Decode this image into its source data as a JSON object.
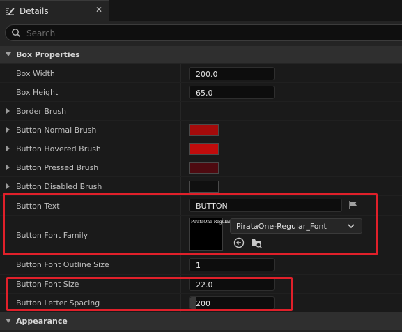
{
  "tab": {
    "title": "Details",
    "close": "✕"
  },
  "search": {
    "placeholder": "Search"
  },
  "categories": [
    {
      "label": "Box Properties"
    },
    {
      "label": "Appearance"
    }
  ],
  "properties": {
    "box_width": {
      "label": "Box Width",
      "value": "200.0"
    },
    "box_height": {
      "label": "Box Height",
      "value": "65.0"
    },
    "border_brush": {
      "label": "Border Brush"
    },
    "normal_brush": {
      "label": "Button Normal Brush",
      "color": "#a40b0b"
    },
    "hovered_brush": {
      "label": "Button Hovered Brush",
      "color": "#c00c0c"
    },
    "pressed_brush": {
      "label": "Button Pressed Brush",
      "color": "#4e0a10"
    },
    "disabled_brush": {
      "label": "Button Disabled Brush",
      "color": "#101010"
    },
    "button_text": {
      "label": "Button Text",
      "value": "BUTTON"
    },
    "font_family": {
      "label": "Button Font Family",
      "value": "PirataOne-Regular_Font",
      "thumbnail_text": "PirataOne-Regular"
    },
    "outline_size": {
      "label": "Button Font Outline Size",
      "value": "1"
    },
    "font_size": {
      "label": "Button Font Size",
      "value": "22.0"
    },
    "letter_spacing": {
      "label": "Button Letter Spacing",
      "value": "200"
    }
  },
  "colors": {
    "highlight_box": "#e0202a",
    "panel_bg": "#1a1a1a",
    "category_bg": "#2f2f2f"
  }
}
